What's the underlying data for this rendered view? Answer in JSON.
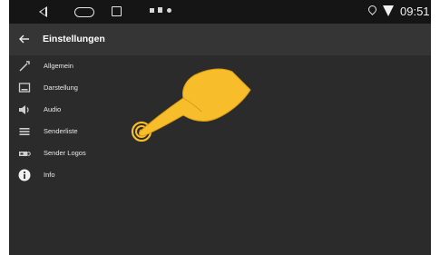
{
  "statusbar": {
    "time": "09:51",
    "icons": [
      "back-icon",
      "home-icon",
      "recent-apps-icon",
      "notification-icon",
      "battery-icon",
      "media-icon",
      "location-icon",
      "wifi-icon"
    ]
  },
  "toolbar": {
    "title": "Einstellungen",
    "back_icon": "arrow-left-icon"
  },
  "menu": {
    "items": [
      {
        "label": "Allgemein",
        "icon": "wrench-icon"
      },
      {
        "label": "Darstellung",
        "icon": "display-icon"
      },
      {
        "label": "Audio",
        "icon": "speaker-icon"
      },
      {
        "label": "Senderliste",
        "icon": "list-icon"
      },
      {
        "label": "Sender Logos",
        "icon": "radio-logo-icon"
      },
      {
        "label": "Info",
        "icon": "info-icon"
      }
    ]
  },
  "overlay": {
    "icon": "pointing-hand-icon",
    "color": "#f7bd2a"
  },
  "colors": {
    "background": "#2b2b2b",
    "toolbar": "#353535",
    "statusbar": "#151515",
    "text": "#e8e8e8"
  }
}
